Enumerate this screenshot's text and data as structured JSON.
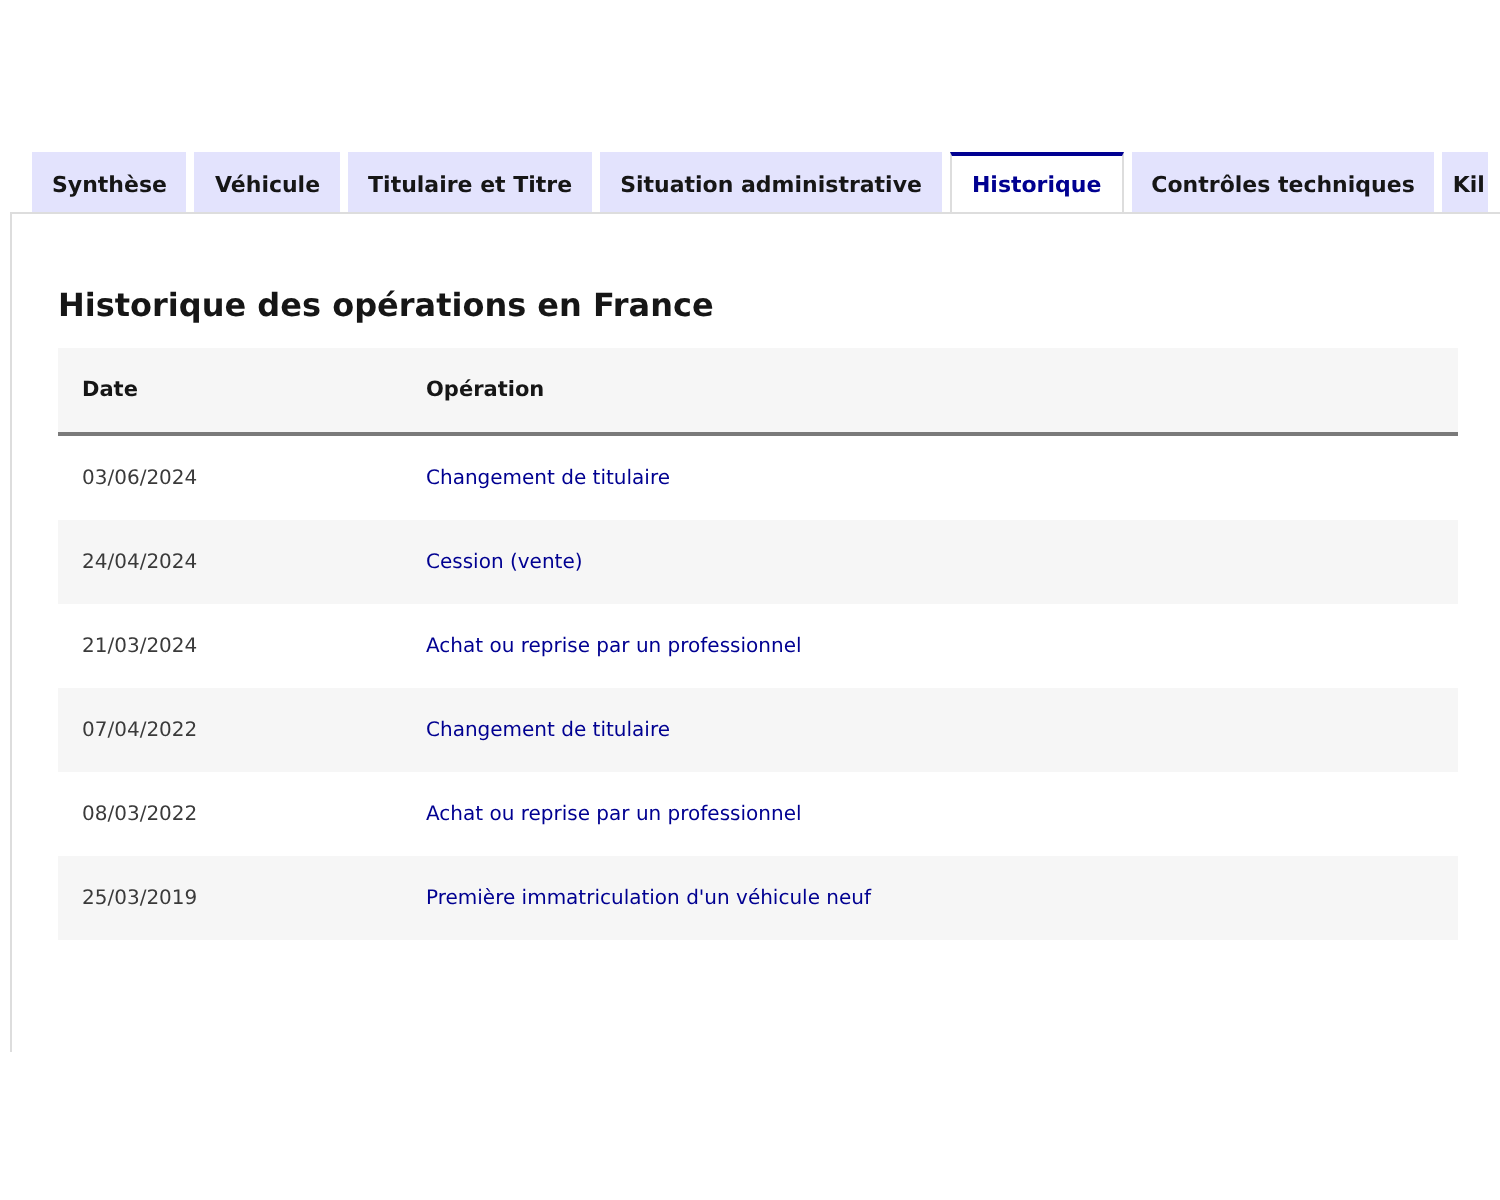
{
  "tabs": [
    {
      "label": "Synthèse",
      "selected": false
    },
    {
      "label": "Véhicule",
      "selected": false
    },
    {
      "label": "Titulaire et Titre",
      "selected": false
    },
    {
      "label": "Situation administrative",
      "selected": false
    },
    {
      "label": "Historique",
      "selected": true
    },
    {
      "label": "Contrôles techniques",
      "selected": false
    },
    {
      "label": "Kil",
      "selected": false
    }
  ],
  "panel": {
    "title": "Historique des opérations en France",
    "table": {
      "columns": [
        "Date",
        "Opération"
      ],
      "rows": [
        {
          "date": "03/06/2024",
          "operation": "Changement de titulaire"
        },
        {
          "date": "24/04/2024",
          "operation": "Cession (vente)"
        },
        {
          "date": "21/03/2024",
          "operation": "Achat ou reprise par un professionnel"
        },
        {
          "date": "07/04/2022",
          "operation": "Changement de titulaire"
        },
        {
          "date": "08/03/2022",
          "operation": "Achat ou reprise par un professionnel"
        },
        {
          "date": "25/03/2019",
          "operation": "Première immatriculation d'un véhicule neuf"
        }
      ]
    }
  }
}
